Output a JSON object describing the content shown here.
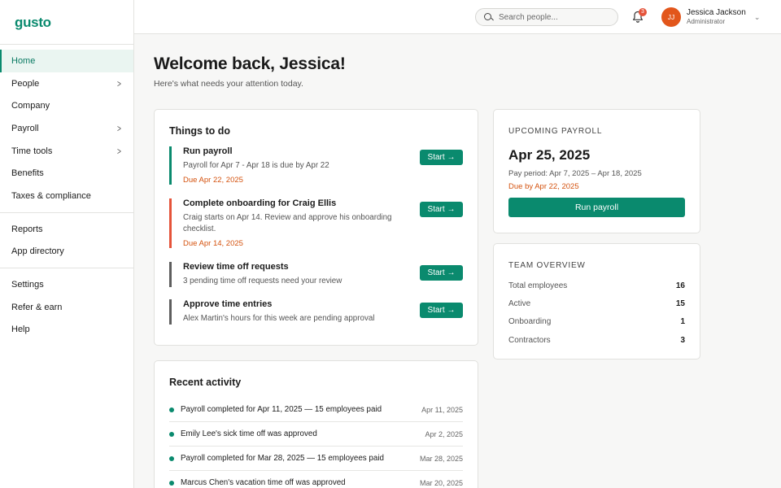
{
  "brand": {
    "logo": "gusto"
  },
  "sidebar": {
    "groups": [
      [
        {
          "label": "Home",
          "active": true,
          "has_children": false
        },
        {
          "label": "People",
          "has_children": true
        },
        {
          "label": "Company",
          "has_children": false
        },
        {
          "label": "Payroll",
          "has_children": true
        },
        {
          "label": "Time tools",
          "has_children": true
        },
        {
          "label": "Benefits",
          "has_children": false
        },
        {
          "label": "Taxes & compliance",
          "has_children": false
        }
      ],
      [
        {
          "label": "Reports",
          "has_children": false
        },
        {
          "label": "App directory",
          "has_children": false
        }
      ],
      [
        {
          "label": "Settings",
          "has_children": false
        },
        {
          "label": "Refer & earn",
          "has_children": false
        },
        {
          "label": "Help",
          "has_children": false
        }
      ]
    ]
  },
  "header": {
    "search_placeholder": "Search people...",
    "notification_count": "3",
    "user": {
      "initials": "JJ",
      "name": "Jessica Jackson",
      "role": "Administrator"
    }
  },
  "main": {
    "title": "Welcome back, Jessica!",
    "subtitle": "Here's what needs your attention today."
  },
  "todo": {
    "title": "Things to do",
    "button_label": "Start →",
    "items": [
      {
        "title": "Run payroll",
        "desc": "Payroll for Apr 7 - Apr 18 is due by Apr 22",
        "due": "Due Apr 22, 2025",
        "color": "#0a8a6e"
      },
      {
        "title": "Complete onboarding for Craig Ellis",
        "desc": "Craig starts on Apr 14. Review and approve his onboarding checklist.",
        "due": "Due Apr 14, 2025",
        "color": "#e5533a"
      },
      {
        "title": "Review time off requests",
        "desc": "3 pending time off requests need your review",
        "due": "",
        "color": "#5e5e5e"
      },
      {
        "title": "Approve time entries",
        "desc": "Alex Martin's hours for this week are pending approval",
        "due": "",
        "color": "#5e5e5e"
      }
    ]
  },
  "activity": {
    "title": "Recent activity",
    "items": [
      {
        "text": "Payroll completed for Apr 11, 2025 — 15 employees paid",
        "date": "Apr 11, 2025"
      },
      {
        "text": "Emily Lee's sick time off was approved",
        "date": "Apr 2, 2025"
      },
      {
        "text": "Payroll completed for Mar 28, 2025 — 15 employees paid",
        "date": "Mar 28, 2025"
      },
      {
        "text": "Marcus Chen's vacation time off was approved",
        "date": "Mar 20, 2025"
      }
    ]
  },
  "upcoming_payroll": {
    "eyebrow": "Upcoming payroll",
    "date": "Apr 25, 2025",
    "period": "Pay period: Apr 7, 2025 – Apr 18, 2025",
    "due": "Due by Apr 22, 2025",
    "button_label": "Run payroll"
  },
  "team_overview": {
    "eyebrow": "Team overview",
    "rows": [
      {
        "label": "Total employees",
        "value": "16"
      },
      {
        "label": "Active",
        "value": "15"
      },
      {
        "label": "Onboarding",
        "value": "1"
      },
      {
        "label": "Contractors",
        "value": "3"
      }
    ]
  },
  "colors": {
    "brand_green": "#0a8a6e",
    "alert_orange": "#d4520e",
    "avatar": "#e2561b"
  }
}
